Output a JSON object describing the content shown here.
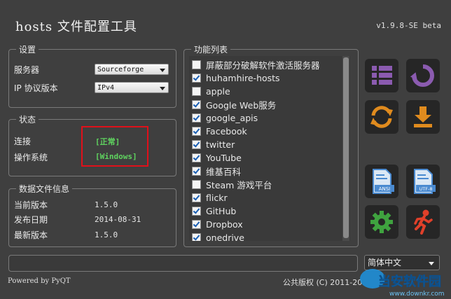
{
  "app": {
    "title": "hosts 文件配置工具",
    "version": "v1.9.8-SE beta"
  },
  "settings": {
    "group_title": "设置",
    "server_label": "服务器",
    "server_value": "Sourceforge",
    "ip_label": "IP 协议版本",
    "ip_value": "IPv4"
  },
  "status": {
    "group_title": "状态",
    "connection_label": "连接",
    "connection_value": "[正常]",
    "os_label": "操作系统",
    "os_value": "[Windows]"
  },
  "datainfo": {
    "group_title": "数据文件信息",
    "current_version_label": "当前版本",
    "current_version_value": "1.5.0",
    "release_date_label": "发布日期",
    "release_date_value": "2014-08-31",
    "latest_version_label": "最新版本",
    "latest_version_value": "1.5.0"
  },
  "functions": {
    "group_title": "功能列表",
    "items": [
      {
        "label": "屏蔽部分破解软件激活服务器",
        "checked": false
      },
      {
        "label": "huhamhire-hosts",
        "checked": true
      },
      {
        "label": "apple",
        "checked": false
      },
      {
        "label": "Google Web服务",
        "checked": true
      },
      {
        "label": "google_apis",
        "checked": true
      },
      {
        "label": "Facebook",
        "checked": true
      },
      {
        "label": "twitter",
        "checked": true
      },
      {
        "label": "YouTube",
        "checked": true
      },
      {
        "label": "维基百科",
        "checked": true
      },
      {
        "label": "Steam 游戏平台",
        "checked": false
      },
      {
        "label": "flickr",
        "checked": true
      },
      {
        "label": "GitHub",
        "checked": true
      },
      {
        "label": "Dropbox",
        "checked": true
      },
      {
        "label": "onedrive",
        "checked": true
      }
    ]
  },
  "toolbar": {
    "icons": [
      "list-icon",
      "restore-icon",
      "refresh-icon",
      "download-icon",
      "ansi-file-icon",
      "utf8-file-icon",
      "gear-icon",
      "exit-icon"
    ],
    "ansi_text": "ANSI",
    "utf8_text": "UTF-8",
    "colors": {
      "purple": "#8b5bb0",
      "orange": "#e08b1e",
      "blue": "#4a8ad0",
      "green": "#3fa33f",
      "red": "#e0402a"
    }
  },
  "language": {
    "value": "简体中文"
  },
  "footer": {
    "powered": "Powered by PyQT",
    "copyright": "公共版权 (C) 2011-20"
  },
  "watermark": {
    "text": "当安软件园",
    "url": "www.downkr.com"
  }
}
